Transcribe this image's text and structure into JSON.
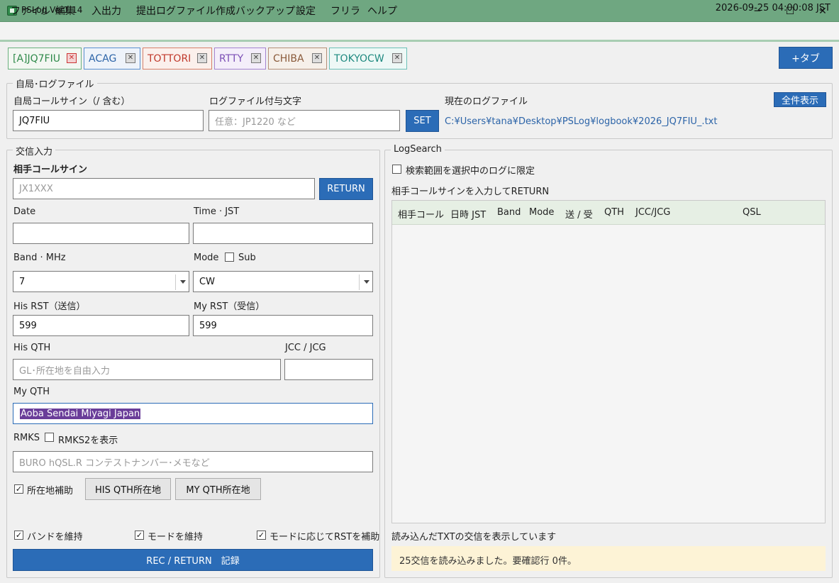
{
  "window": {
    "title": "PSLog Ver1.14",
    "min": "─",
    "max": "☐",
    "close": "✕"
  },
  "menu": [
    "ファイル",
    "編集",
    "入出力",
    "提出ログファイル作成",
    "バックアップ",
    "設定",
    "フリラ",
    "ヘルプ"
  ],
  "clock": "2026-09-25 04:00:08 JST",
  "tabs": [
    {
      "label": "[A]JQ7FIU",
      "color": "#2f8a4a",
      "border": "#6ab07e",
      "bg": "#f3f7f2"
    },
    {
      "label": "ACAG",
      "color": "#2c64a8",
      "border": "#5a8fd0",
      "bg": "#eef3fa"
    },
    {
      "label": "TOTTORI",
      "color": "#c0392b",
      "border": "#d7806a",
      "bg": "#fbf0ec"
    },
    {
      "label": "RTTY",
      "color": "#7b4fb5",
      "border": "#a583cf",
      "bg": "#f4eefa"
    },
    {
      "label": "CHIBA",
      "color": "#8a5a3a",
      "border": "#b59078",
      "bg": "#f6f0ea"
    },
    {
      "label": "TOKYOCW",
      "color": "#1f8a80",
      "border": "#6cc0b7",
      "bg": "#eef8f6"
    }
  ],
  "tab_close": "✕",
  "add_tab": "+タブ",
  "station": {
    "title": "自局･ログファイル",
    "callsign_label": "自局コールサイン（/ 含む）",
    "callsign_value": "JQ7FIU",
    "suffix_label": "ログファイル付与文字",
    "suffix_placeholder": "任意：JP1220 など",
    "set_button": "SET",
    "current_label": "現在のログファイル",
    "show_all": "全件表示",
    "path": "C:¥Users¥tana¥Desktop¥PSLog¥logbook¥2026_JQ7FIU_.txt"
  },
  "qso": {
    "title": "交信入力",
    "call_label": "相手コールサイン",
    "call_placeholder": "JX1XXX",
    "return_button": "RETURN",
    "date_label": "Date",
    "time_label": "Time · JST",
    "band_label": "Band · MHz",
    "band_value": "7",
    "mode_label": "Mode",
    "sub_label": "Sub",
    "mode_value": "CW",
    "his_rst_label": "His RST（送信）",
    "his_rst_value": "599",
    "my_rst_label": "My RST（受信）",
    "my_rst_value": "599",
    "his_qth_label": "His QTH",
    "his_qth_placeholder": "GL･所在地を自由入力",
    "jcc_label": "JCC / JCG",
    "my_qth_label": "My QTH",
    "my_qth_value": "Aoba Sendai Miyagi Japan",
    "rmks_label": "RMKS",
    "rmks2_label": "RMKS2を表示",
    "rmks_placeholder": "BURO  hQSL.R  コンテストナンバー･メモなど",
    "loc_assist_label": "所在地補助",
    "his_qth_loc_button": "HIS QTH所在地",
    "my_qth_loc_button": "MY QTH所在地",
    "keep_band_label": "バンドを維持",
    "keep_mode_label": "モードを維持",
    "rst_assist_label": "モードに応じてRSTを補助",
    "record_button": "REC / RETURN　記録",
    "check_mark": "✓"
  },
  "search": {
    "title": "LogSearch",
    "limit_label": "検索範囲を選択中のログに限定",
    "hint": "相手コールサインを入力してRETURN",
    "columns": [
      "相手コール",
      "日時 JST",
      "Band",
      "Mode",
      "送 / 受",
      "QTH",
      "JCC/JCG",
      "QSL"
    ],
    "footer": "読み込んだTXTの交信を表示しています",
    "status": "25交信を読み込みました。要確認行 0件。"
  }
}
